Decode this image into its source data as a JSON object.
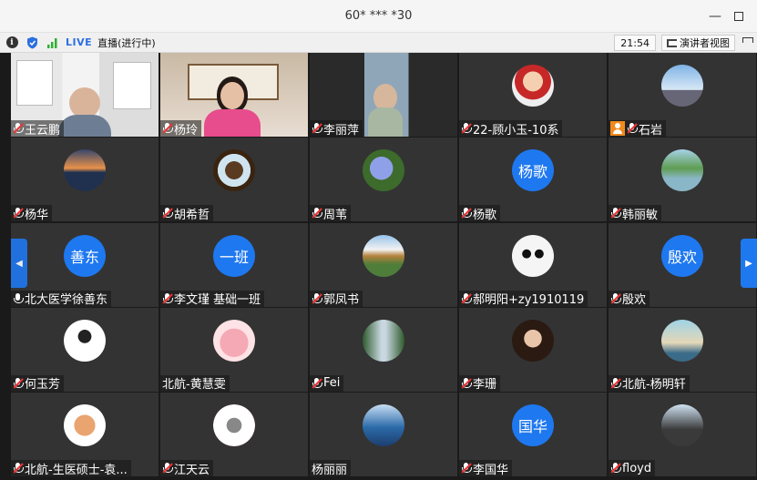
{
  "window": {
    "title": "60* *** *30"
  },
  "toolbar": {
    "live_label": "LIVE",
    "live_status": "直播(进行中)",
    "timer": "21:54",
    "presenter_view_label": "演讲者视图"
  },
  "colors": {
    "accent": "#1e78f0",
    "tile_bg": "#333333",
    "mute_red": "#e33333",
    "host_orange": "#f08a1c"
  },
  "participants": [
    {
      "name": "王云鹏",
      "kind": "video",
      "mic": "muted"
    },
    {
      "name": "杨玲",
      "kind": "video",
      "mic": "muted"
    },
    {
      "name": "李丽萍",
      "kind": "video",
      "mic": "muted"
    },
    {
      "name": "22-顾小玉-10系",
      "kind": "photo",
      "icon": "cartoon-girl-avatar",
      "mic": "muted"
    },
    {
      "name": "石岩",
      "kind": "photo",
      "icon": "tower-photo-avatar",
      "mic": "muted",
      "host": true
    },
    {
      "name": "杨华",
      "kind": "photo",
      "icon": "sunset-pier-avatar",
      "mic": "muted"
    },
    {
      "name": "胡希哲",
      "kind": "photo",
      "icon": "snake-photo-avatar",
      "mic": "muted"
    },
    {
      "name": "周苇",
      "kind": "photo",
      "icon": "flower-photo-avatar",
      "mic": "muted"
    },
    {
      "name": "杨歌",
      "kind": "text",
      "avatar_text": "杨歌",
      "mic": "muted"
    },
    {
      "name": "韩丽敏",
      "kind": "photo",
      "icon": "lake-trees-avatar",
      "mic": "muted"
    },
    {
      "name": "北大医学徐善东",
      "kind": "text",
      "avatar_text": "善东",
      "mic": "on"
    },
    {
      "name": "李文瑾 基础一班",
      "kind": "text",
      "avatar_text": "一班",
      "mic": "muted"
    },
    {
      "name": "郭凤书",
      "kind": "photo",
      "icon": "pagoda-photo-avatar",
      "mic": "muted"
    },
    {
      "name": "郝明阳+zy1910119",
      "kind": "photo",
      "icon": "panda-avatar",
      "mic": "muted"
    },
    {
      "name": "殷欢",
      "kind": "text",
      "avatar_text": "殷欢",
      "mic": "muted"
    },
    {
      "name": "何玉芳",
      "kind": "photo",
      "icon": "fighting-cartoon-avatar",
      "mic": "muted"
    },
    {
      "name": "北航-黄慧雯",
      "kind": "photo",
      "icon": "pig-cartoon-avatar",
      "mic": "none"
    },
    {
      "name": "Fei",
      "kind": "photo",
      "icon": "waterfall-photo-avatar",
      "mic": "muted"
    },
    {
      "name": "李珊",
      "kind": "photo",
      "icon": "girl-photo-avatar",
      "mic": "muted"
    },
    {
      "name": "北航-杨明轩",
      "kind": "photo",
      "icon": "beach-photo-avatar",
      "mic": "muted"
    },
    {
      "name": "北航-生医硕士-袁...",
      "kind": "photo",
      "icon": "dog-cartoon-avatar",
      "mic": "muted"
    },
    {
      "name": "江天云",
      "kind": "photo",
      "icon": "totoro-badge-avatar",
      "mic": "muted"
    },
    {
      "name": "杨丽丽",
      "kind": "photo",
      "icon": "mountain-lake-avatar",
      "mic": "none"
    },
    {
      "name": "李国华",
      "kind": "text",
      "avatar_text": "国华",
      "mic": "muted"
    },
    {
      "name": "floyd",
      "kind": "photo",
      "icon": "man-photo-avatar",
      "mic": "muted"
    }
  ]
}
